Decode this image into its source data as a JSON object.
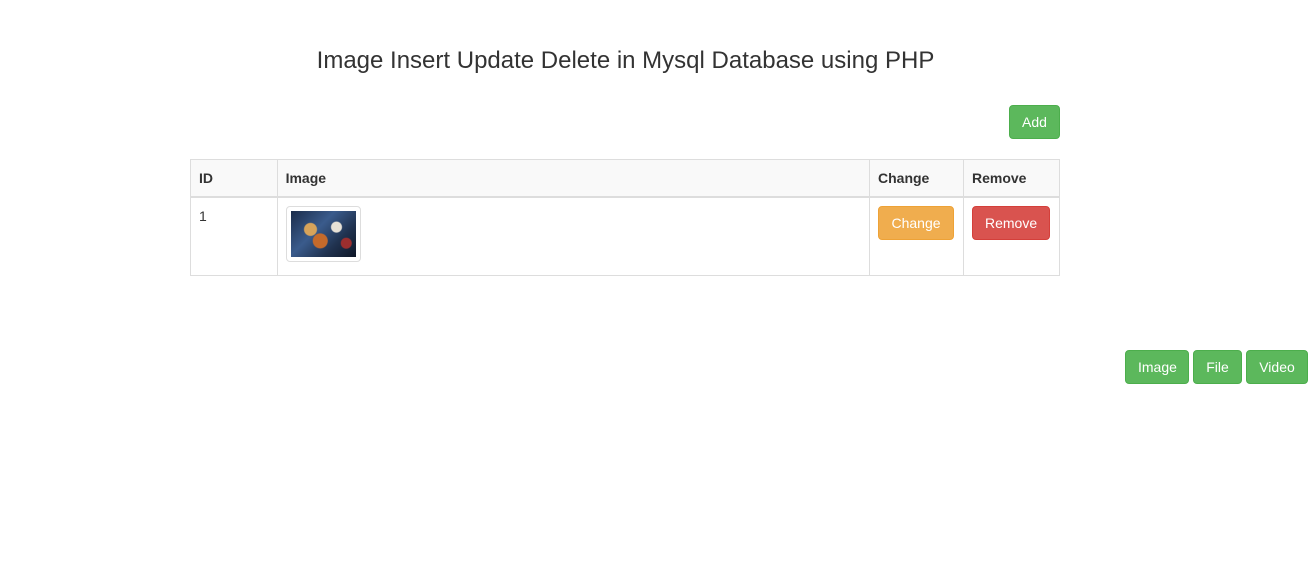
{
  "page": {
    "title": "Image Insert Update Delete in Mysql Database using PHP"
  },
  "toolbar": {
    "add_label": "Add"
  },
  "table": {
    "headers": [
      "ID",
      "Image",
      "Change",
      "Remove"
    ],
    "rows": [
      {
        "id": "1",
        "image_icon": "thumbnail-image",
        "change_label": "Change",
        "remove_label": "Remove"
      }
    ]
  },
  "bottom_nav": {
    "items": [
      "Image",
      "File",
      "Video"
    ]
  },
  "colors": {
    "success": "#5cb85c",
    "warning": "#f0ad4e",
    "danger": "#d9534f"
  }
}
